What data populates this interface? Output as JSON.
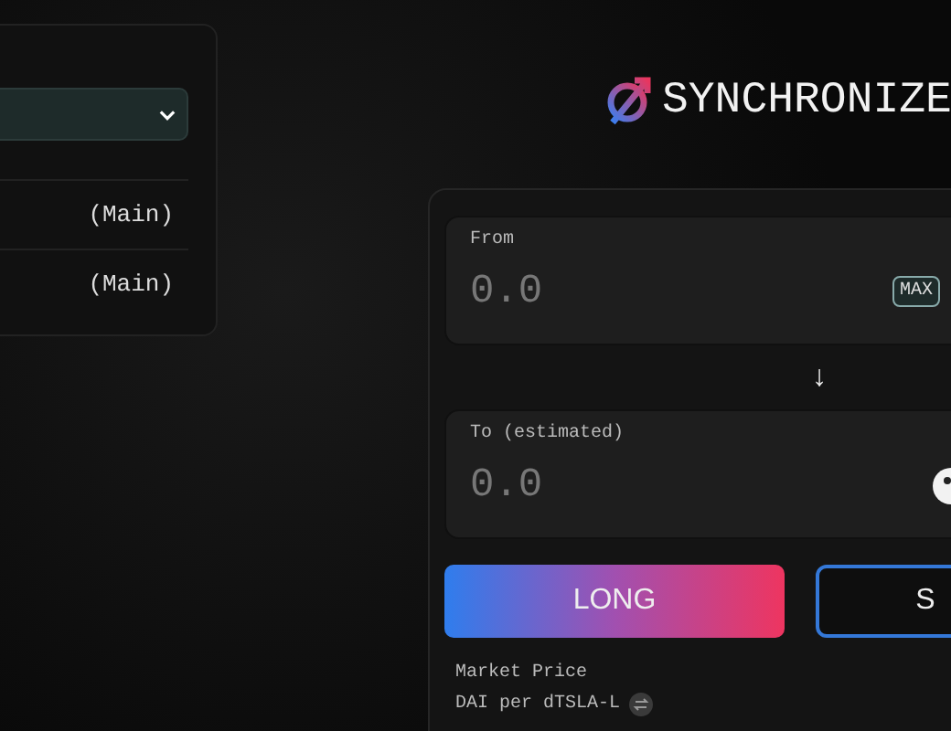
{
  "network_panel": {
    "rows": [
      {
        "label": "(Main)"
      },
      {
        "label": "(Main)"
      }
    ]
  },
  "logo": {
    "text": "SYNCHRONIZE"
  },
  "swap": {
    "from": {
      "label": "From",
      "placeholder": "0.0",
      "max": "MAX"
    },
    "arrow": "↓",
    "to": {
      "label": "To (estimated)",
      "placeholder": "0.0"
    },
    "buttons": [
      {
        "label": "LONG",
        "kind": "long"
      },
      {
        "label": "S",
        "kind": "short"
      }
    ],
    "market_price": {
      "label": "Market Price",
      "pair": "DAI per dTSLA-L"
    }
  }
}
